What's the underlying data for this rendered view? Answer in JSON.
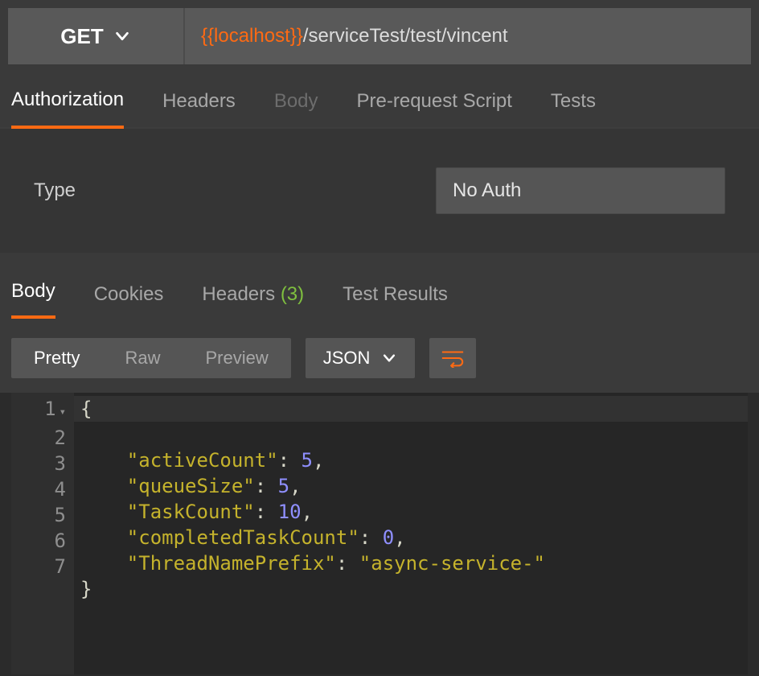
{
  "request": {
    "method": "GET",
    "url_variable": "{{localhost}}",
    "url_path": "/serviceTest/test/vincent"
  },
  "request_tabs": {
    "authorization": "Authorization",
    "headers": "Headers",
    "body": "Body",
    "pre_request": "Pre-request Script",
    "tests": "Tests"
  },
  "auth": {
    "type_label": "Type",
    "selected": "No Auth"
  },
  "response_tabs": {
    "body": "Body",
    "cookies": "Cookies",
    "headers": "Headers",
    "headers_count": "(3)",
    "test_results": "Test Results"
  },
  "view_modes": {
    "pretty": "Pretty",
    "raw": "Raw",
    "preview": "Preview"
  },
  "format": "JSON",
  "response_body": {
    "lines": [
      "1",
      "2",
      "3",
      "4",
      "5",
      "6",
      "7"
    ],
    "json": {
      "activeCount": 5,
      "queueSize": 5,
      "TaskCount": 10,
      "completedTaskCount": 0,
      "ThreadNamePrefix": "async-service-"
    }
  }
}
